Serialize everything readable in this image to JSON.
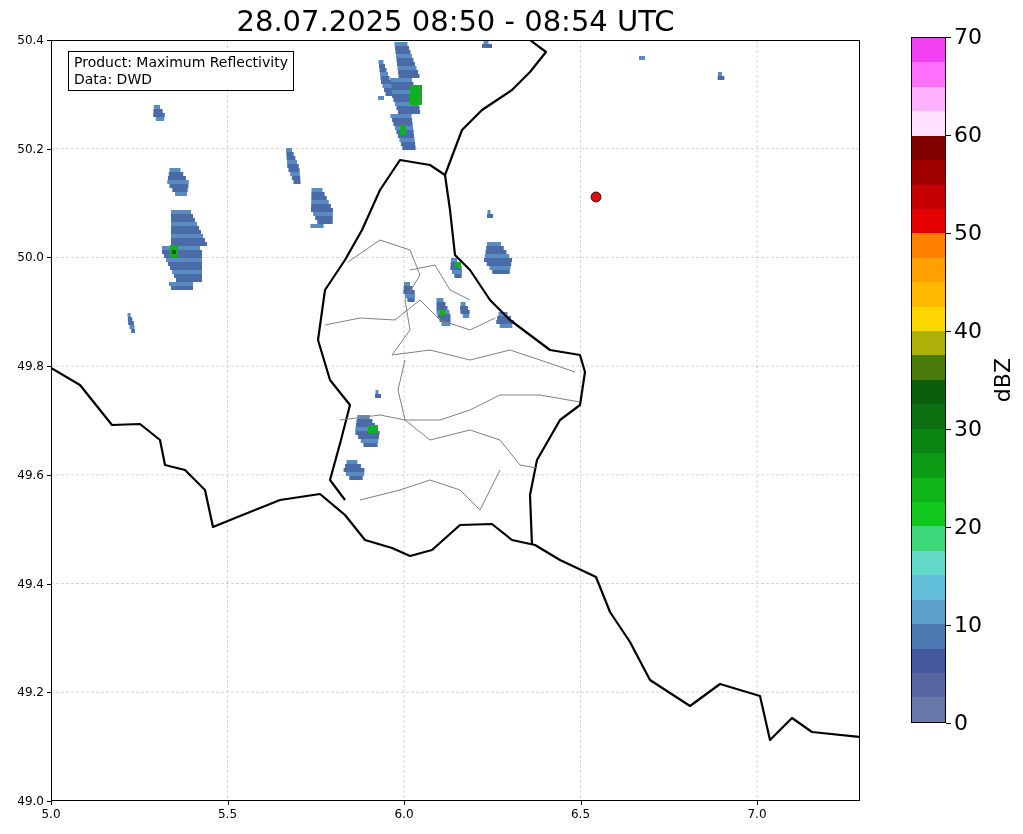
{
  "title": "28.07.2025 08:50 - 08:54 UTC",
  "info_box": {
    "lines": [
      "Product: Maximum Reflectivity",
      "Data: DWD"
    ]
  },
  "x_axis": {
    "ticks": [
      "5.0",
      "5.5",
      "6.0",
      "6.5",
      "7.0"
    ]
  },
  "y_axis": {
    "ticks": [
      "50.4",
      "50.2",
      "50.0",
      "49.8",
      "49.6",
      "49.4",
      "49.2",
      "49.0"
    ]
  },
  "colorbar": {
    "label": "dBZ",
    "ticks": [
      "70",
      "60",
      "50",
      "40",
      "30",
      "20",
      "10",
      "0"
    ],
    "bins": [
      {
        "color": "#f040f0"
      },
      {
        "color": "#ff70ff"
      },
      {
        "color": "#ffb0ff"
      },
      {
        "color": "#ffe0ff"
      },
      {
        "color": "#800000"
      },
      {
        "color": "#a00000"
      },
      {
        "color": "#c40000"
      },
      {
        "color": "#e40000"
      },
      {
        "color": "#ff8000"
      },
      {
        "color": "#ffa000"
      },
      {
        "color": "#ffba00"
      },
      {
        "color": "#ffd700"
      },
      {
        "color": "#b0b00a"
      },
      {
        "color": "#4a7a0c"
      },
      {
        "color": "#0a5e0c"
      },
      {
        "color": "#0a7010"
      },
      {
        "color": "#0a8410"
      },
      {
        "color": "#0c9c14"
      },
      {
        "color": "#0eb418"
      },
      {
        "color": "#10c81c"
      },
      {
        "color": "#3ed87a"
      },
      {
        "color": "#62d8c8"
      },
      {
        "color": "#62c0da"
      },
      {
        "color": "#5aa0c8"
      },
      {
        "color": "#4a78b0"
      },
      {
        "color": "#44599c"
      },
      {
        "color": "#5566a0"
      },
      {
        "color": "#6677a8"
      }
    ]
  }
}
